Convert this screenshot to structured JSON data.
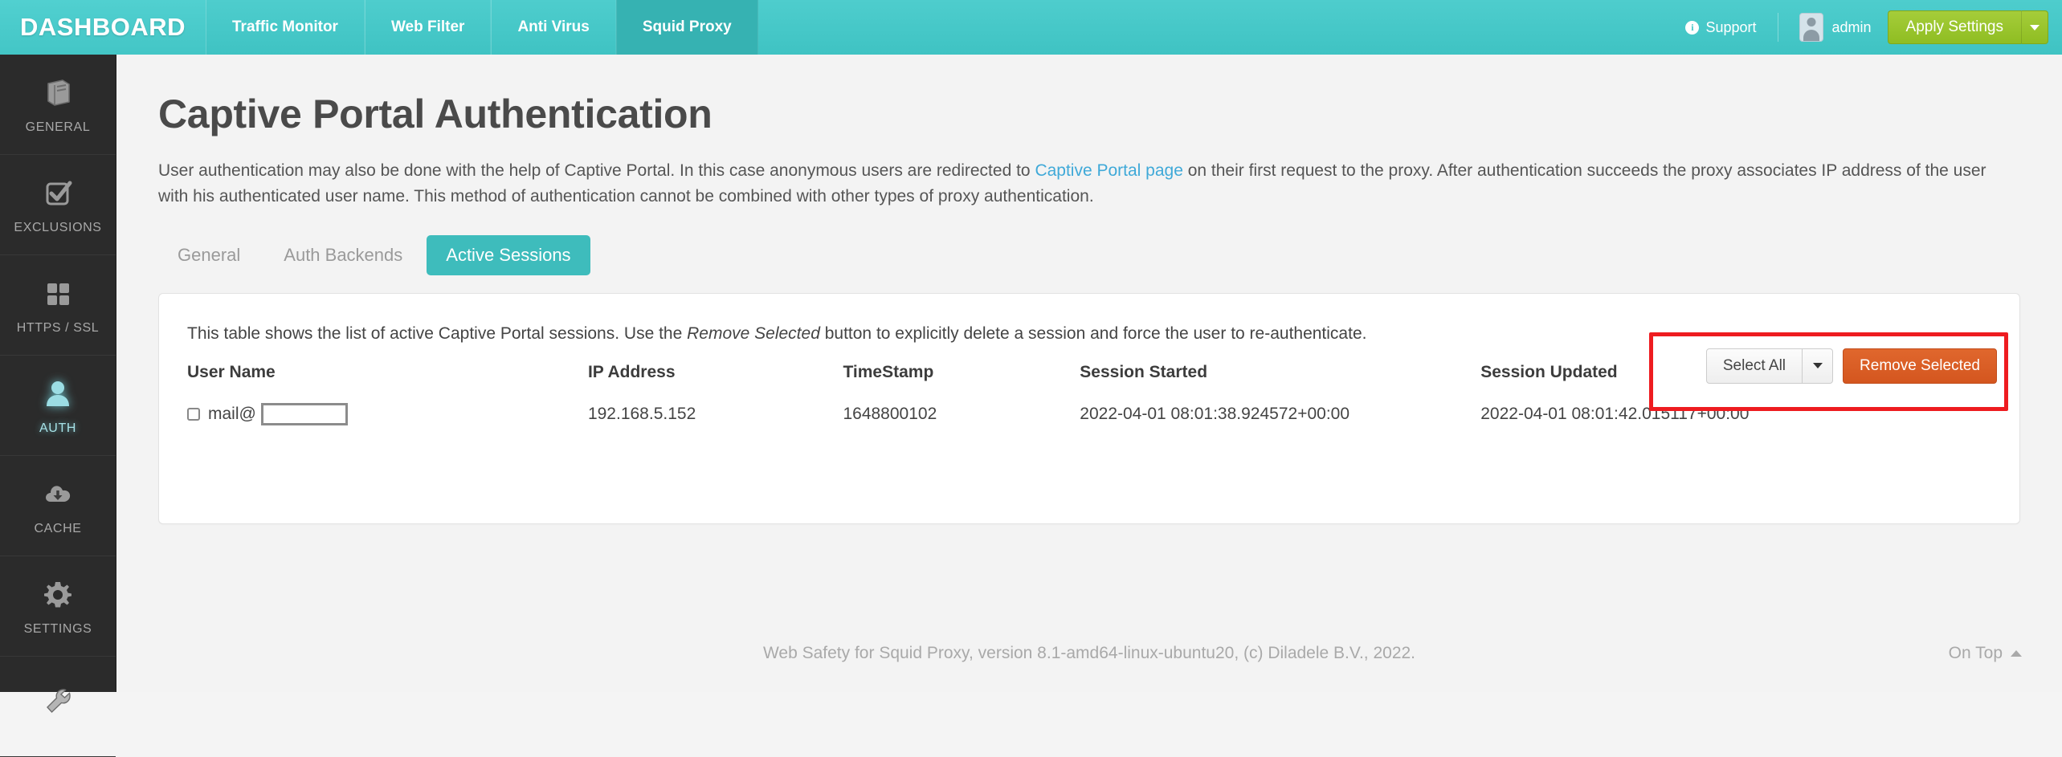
{
  "topbar": {
    "brand": "DASHBOARD",
    "nav": [
      {
        "label": "Traffic Monitor",
        "active": false
      },
      {
        "label": "Web Filter",
        "active": false
      },
      {
        "label": "Anti Virus",
        "active": false
      },
      {
        "label": "Squid Proxy",
        "active": true
      }
    ],
    "support_label": "Support",
    "info_glyph": "i",
    "user_name": "admin",
    "apply_label": "Apply Settings",
    "accent_color": "#3fc3c3",
    "apply_color": "#8fbd22"
  },
  "sidebar": {
    "items": [
      {
        "label": "GENERAL",
        "icon": "book-icon",
        "active": false
      },
      {
        "label": "EXCLUSIONS",
        "icon": "check-square-icon",
        "active": false
      },
      {
        "label": "HTTPS / SSL",
        "icon": "grid-squares-icon",
        "active": false
      },
      {
        "label": "AUTH",
        "icon": "user-icon",
        "active": true
      },
      {
        "label": "CACHE",
        "icon": "cloud-download-icon",
        "active": false
      },
      {
        "label": "SETTINGS",
        "icon": "gear-icon",
        "active": false
      },
      {
        "label": "",
        "icon": "wrench-icon",
        "active": false
      }
    ]
  },
  "page": {
    "title": "Captive Portal Authentication",
    "intro_part1": "User authentication may also be done with the help of Captive Portal. In this case anonymous users are redirected to ",
    "intro_link": "Captive Portal page",
    "intro_part2": " on their first request to the proxy. After authentication succeeds the proxy associates IP address of the user with his authenticated user name. This method of authentication cannot be combined with other types of proxy authentication.",
    "tabs": [
      {
        "label": "General",
        "active": false
      },
      {
        "label": "Auth Backends",
        "active": false
      },
      {
        "label": "Active Sessions",
        "active": true
      }
    ]
  },
  "panel": {
    "note_part1": "This table shows the list of active Captive Portal sessions. Use the ",
    "note_emphasis": "Remove Selected",
    "note_part2": " button to explicitly delete a session and force the user to re-authenticate.",
    "select_all_label": "Select All",
    "remove_selected_label": "Remove Selected",
    "highlight_color": "#ee1c20",
    "remove_button_color": "#d4561f"
  },
  "table": {
    "columns": [
      "User Name",
      "IP Address",
      "TimeStamp",
      "Session Started",
      "Session Updated"
    ],
    "rows": [
      {
        "user_name": "mail@",
        "user_name_redacted": true,
        "ip_address": "192.168.5.152",
        "timestamp": "1648800102",
        "session_started": "2022-04-01 08:01:38.924572+00:00",
        "session_updated": "2022-04-01 08:01:42.015117+00:00",
        "checked": false
      }
    ]
  },
  "footer": {
    "text": "Web Safety for Squid Proxy, version 8.1-amd64-linux-ubuntu20, (c) Diladele B.V., 2022.",
    "on_top_label": "On Top"
  }
}
